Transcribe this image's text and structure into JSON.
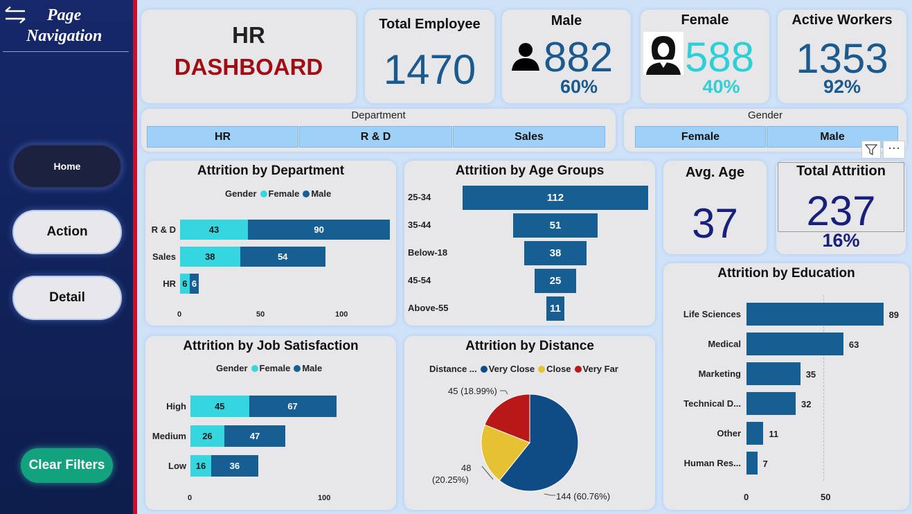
{
  "nav": {
    "title_line1": "Page",
    "title_line2": "Navigation",
    "home": "Home",
    "action": "Action",
    "detail": "Detail",
    "clear_filters": "Clear Filters"
  },
  "header": {
    "line1": "HR",
    "line2": "DASHBOARD"
  },
  "kpi": {
    "total_employee": {
      "label": "Total Employee",
      "value": "1470"
    },
    "male": {
      "label": "Male",
      "value": "882",
      "pct": "60%"
    },
    "female": {
      "label": "Female",
      "value": "588",
      "pct": "40%"
    },
    "active": {
      "label": "Active Workers",
      "value": "1353",
      "pct": "92%"
    },
    "avg_age": {
      "label": "Avg. Age",
      "value": "37"
    },
    "attrition": {
      "label": "Total Attrition",
      "value": "237",
      "pct": "16%"
    }
  },
  "slicers": {
    "department": {
      "title": "Department",
      "options": [
        "HR",
        "R & D",
        "Sales"
      ]
    },
    "gender": {
      "title": "Gender",
      "options": [
        "Female",
        "Male"
      ]
    }
  },
  "legend": {
    "gender": "Gender",
    "female": "Female",
    "male": "Male",
    "distance": "Distance ...",
    "very_close": "Very Close",
    "close": "Close",
    "very_far": "Very Far"
  },
  "colors": {
    "female": "#36d6e0",
    "male": "#175e93",
    "very_close": "#0f4c86",
    "close": "#e6c233",
    "very_far": "#b81818",
    "accent_red": "#a00d12"
  },
  "chart_data": [
    {
      "type": "bar",
      "title": "Attrition by Department",
      "categories": [
        "R & D",
        "Sales",
        "HR"
      ],
      "series": [
        {
          "name": "Female",
          "values": [
            43,
            38,
            6
          ]
        },
        {
          "name": "Male",
          "values": [
            90,
            54,
            6
          ]
        }
      ],
      "xticks": [
        "0",
        "50",
        "100"
      ],
      "stacked": true
    },
    {
      "type": "bar",
      "title": "Attrition by Age Groups",
      "categories": [
        "25-34",
        "35-44",
        "Below-18",
        "45-54",
        "Above-55"
      ],
      "values": [
        112,
        51,
        38,
        25,
        11
      ]
    },
    {
      "type": "bar",
      "title": "Attrition by Job Satisfaction",
      "categories": [
        "High",
        "Medium",
        "Low"
      ],
      "series": [
        {
          "name": "Female",
          "values": [
            45,
            26,
            16
          ]
        },
        {
          "name": "Male",
          "values": [
            67,
            47,
            36
          ]
        }
      ],
      "xticks": [
        "0",
        "100"
      ],
      "stacked": true
    },
    {
      "type": "pie",
      "title": "Attrition by Distance",
      "categories": [
        "Very Close",
        "Close",
        "Very Far"
      ],
      "values": [
        144,
        48,
        45
      ],
      "labels": [
        "144 (60.76%)",
        "48",
        "(20.25%)",
        "45 (18.99%)"
      ]
    },
    {
      "type": "bar",
      "title": "Attrition by Education",
      "categories": [
        "Life Sciences",
        "Medical",
        "Marketing",
        "Technical D...",
        "Other",
        "Human Res..."
      ],
      "values": [
        89,
        63,
        35,
        32,
        11,
        7
      ],
      "xticks": [
        "0",
        "50"
      ]
    }
  ]
}
